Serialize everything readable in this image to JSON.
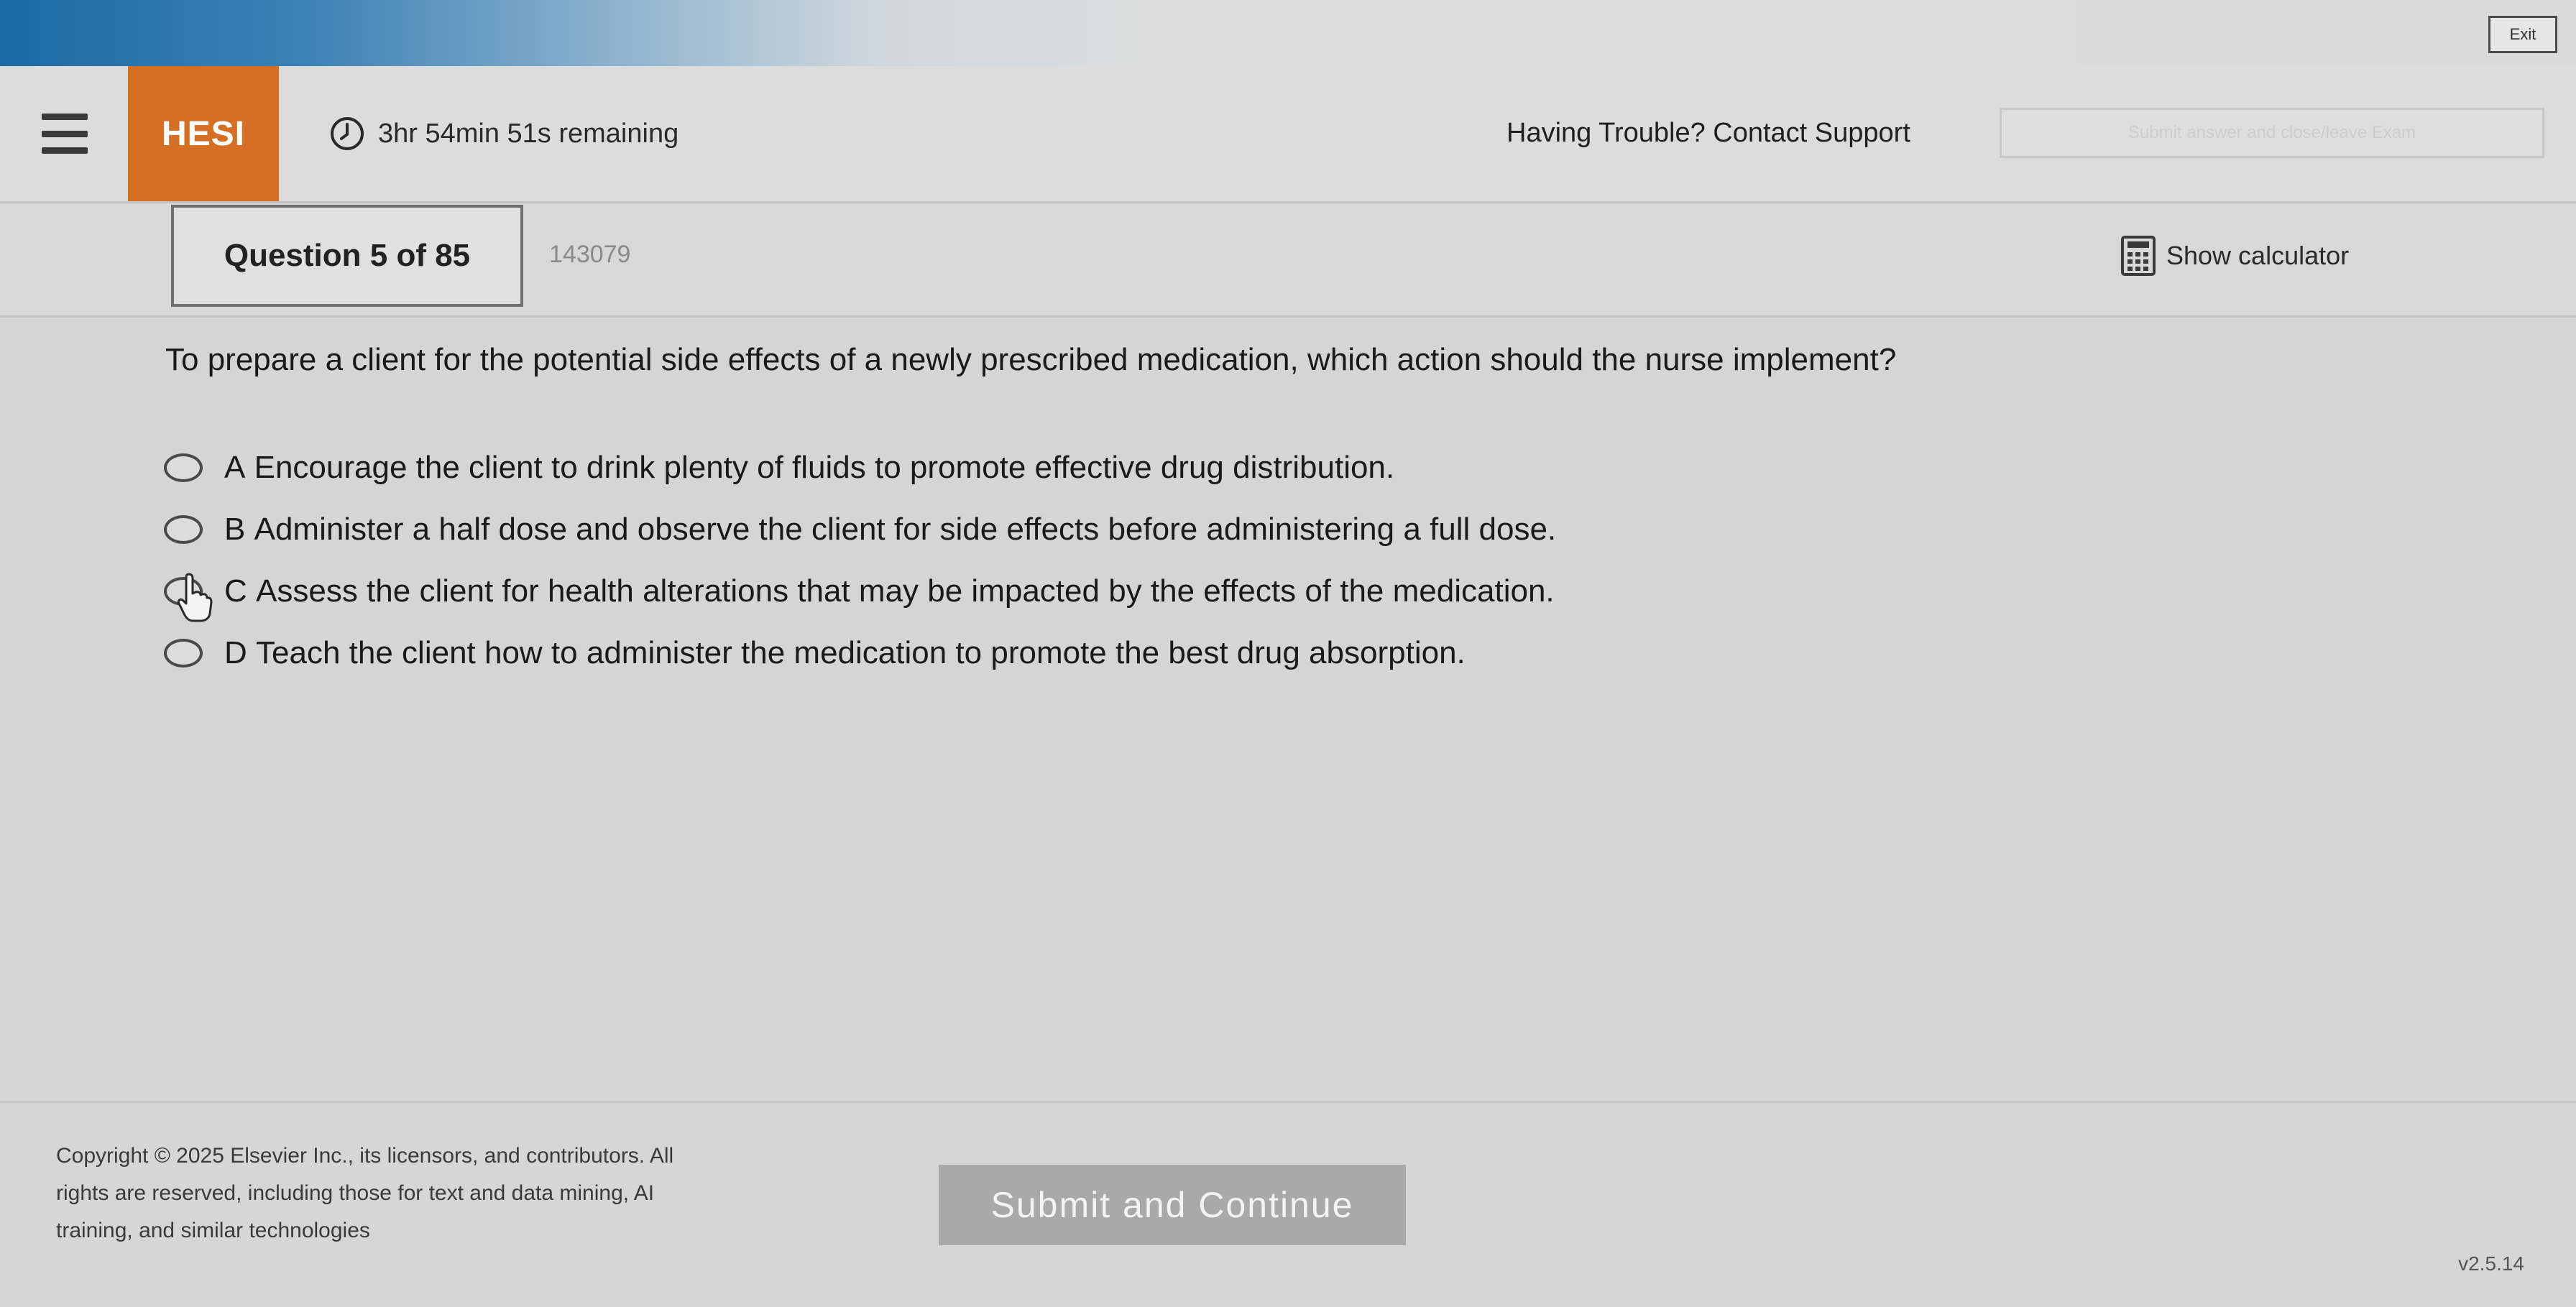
{
  "window": {
    "exit_label": "Exit"
  },
  "header": {
    "brand": "HESI",
    "timer_text": "3hr 54min 51s remaining",
    "support_text": "Having Trouble? Contact Support",
    "submit_exam_label": "Submit answer and close/leave Exam"
  },
  "question_bar": {
    "question_label": "Question 5 of 85",
    "question_id": "143079",
    "calculator_label": "Show calculator"
  },
  "question": {
    "stem": "To prepare a client for the potential side effects of a newly prescribed medication, which action should the nurse implement?",
    "options": [
      {
        "letter": "A",
        "text": "Encourage the client to drink plenty of fluids to promote effective drug distribution."
      },
      {
        "letter": "B",
        "text": "Administer a half dose and observe the client for side effects before administering a full dose."
      },
      {
        "letter": "C",
        "text": "Assess the client for health alterations that may be impacted by the effects of the medication."
      },
      {
        "letter": "D",
        "text": "Teach the client how to administer the medication to promote the best drug absorption."
      }
    ]
  },
  "footer": {
    "copyright": "Copyright © 2025 Elsevier Inc., its licensors, and contributors. All rights are reserved, including those for text and data mining, AI training, and similar technologies",
    "submit_label": "Submit and Continue",
    "version": "v2.5.14"
  },
  "colors": {
    "brand_orange": "#d56f24",
    "banner_blue": "#1b6aa5",
    "disabled_button": "#a9a9a9"
  }
}
